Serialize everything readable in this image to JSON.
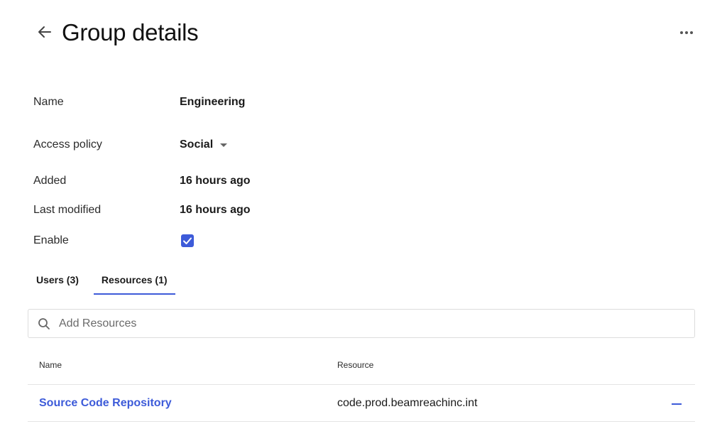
{
  "header": {
    "title": "Group details",
    "back_icon": "arrow-left-icon",
    "more_icon": "more-horizontal-icon"
  },
  "details": {
    "name": {
      "label": "Name",
      "value": "Engineering"
    },
    "access_policy": {
      "label": "Access policy",
      "value": "Social"
    },
    "added": {
      "label": "Added",
      "value": "16 hours ago"
    },
    "last_modified": {
      "label": "Last modified",
      "value": "16 hours ago"
    },
    "enable": {
      "label": "Enable",
      "checked": true
    }
  },
  "tabs": [
    {
      "label": "Users (3)",
      "active": false
    },
    {
      "label": "Resources (1)",
      "active": true
    }
  ],
  "search": {
    "placeholder": "Add Resources",
    "value": ""
  },
  "table": {
    "columns": [
      "Name",
      "Resource"
    ],
    "rows": [
      {
        "name": "Source Code Repository",
        "resource": "code.prod.beamreachinc.int"
      }
    ]
  },
  "colors": {
    "accent": "#3d5bd9",
    "divider": "#e4e4e4"
  }
}
